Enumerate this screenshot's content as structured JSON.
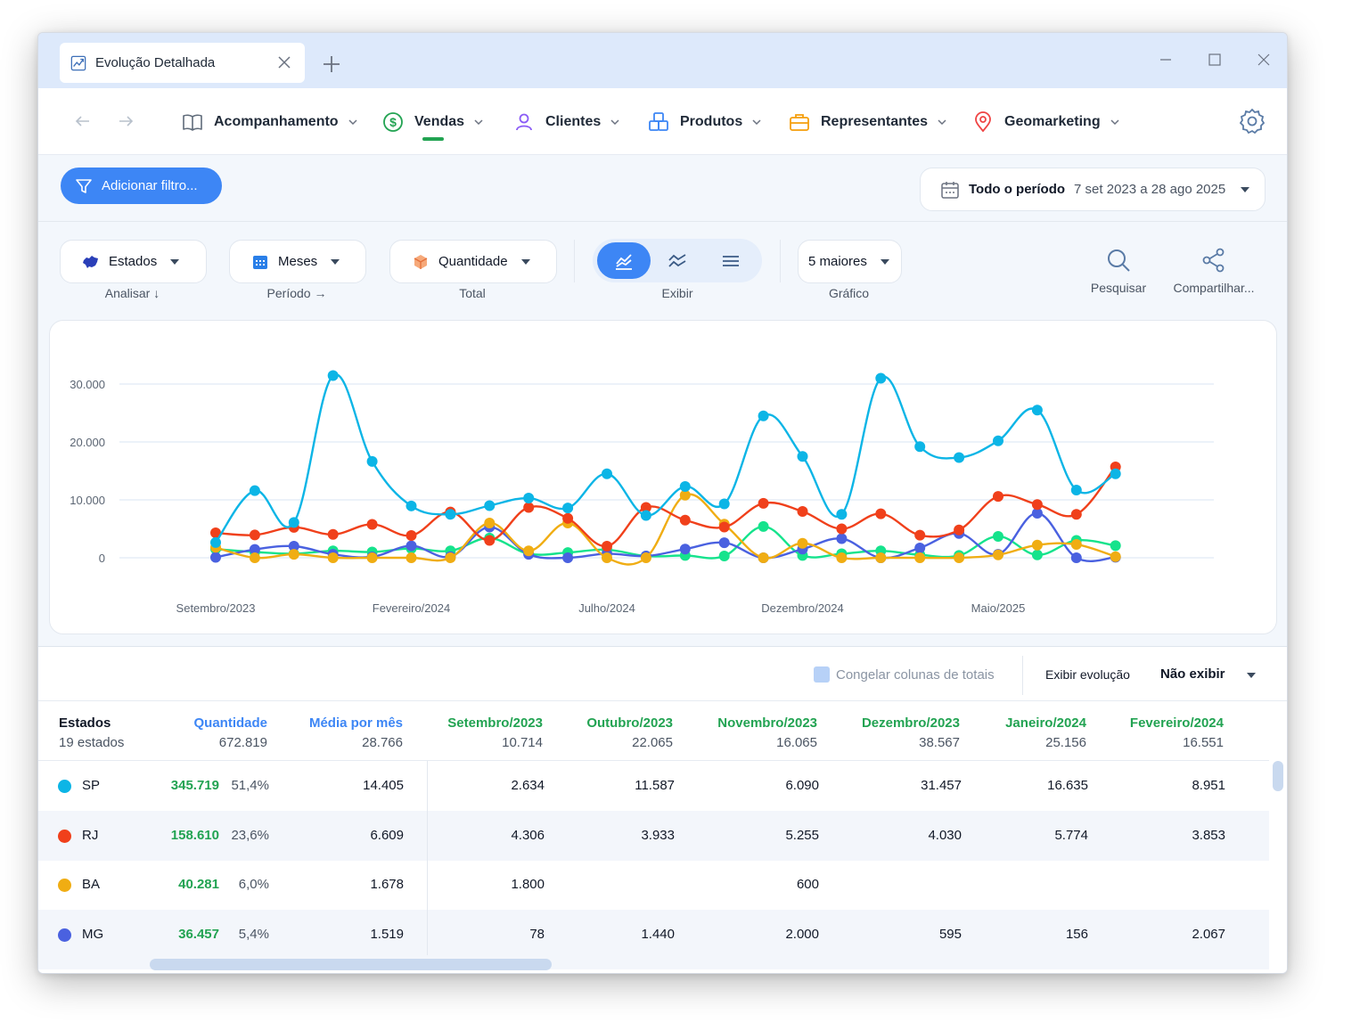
{
  "tab": {
    "title": "Evolução Detalhada"
  },
  "nav": [
    {
      "label": "Acompanhamento",
      "icon": "book-icon",
      "color": "#5f6b7a"
    },
    {
      "label": "Vendas",
      "icon": "dollar-circle-icon",
      "color": "#22a352"
    },
    {
      "label": "Clientes",
      "icon": "user-icon",
      "color": "#8b5cf6"
    },
    {
      "label": "Produtos",
      "icon": "boxes-icon",
      "color": "#3d86f5"
    },
    {
      "label": "Representantes",
      "icon": "briefcase-icon",
      "color": "#f59e0b"
    },
    {
      "label": "Geomarketing",
      "icon": "map-pin-icon",
      "color": "#ef4444"
    }
  ],
  "filter": {
    "add_label": "Adicionar filtro..."
  },
  "period": {
    "label": "Todo o período",
    "range": "7 set 2023 a 28 ago 2025"
  },
  "controls": {
    "analyze": {
      "value": "Estados",
      "caption": "Analisar ↓"
    },
    "period": {
      "value": "Meses",
      "caption": "Período →"
    },
    "total": {
      "value": "Quantidade",
      "caption": "Total"
    },
    "view": {
      "caption": "Exibir"
    },
    "chart": {
      "value": "5 maiores",
      "caption": "Gráfico"
    },
    "search": {
      "caption": "Pesquisar"
    },
    "share": {
      "caption": "Compartilhar..."
    }
  },
  "chart_data": {
    "type": "line",
    "x": [
      "Setembro/2023",
      "Outubro/2023",
      "Novembro/2023",
      "Dezembro/2023",
      "Janeiro/2024",
      "Fevereiro/2024",
      "Março/2024",
      "Abril/2024",
      "Maio/2024",
      "Junho/2024",
      "Julho/2024",
      "Agosto/2024",
      "Setembro/2024",
      "Outubro/2024",
      "Novembro/2024",
      "Dezembro/2024",
      "Janeiro/2025",
      "Fevereiro/2025",
      "Março/2025",
      "Abril/2025",
      "Maio/2025",
      "Junho/2025",
      "Julho/2025",
      "Agosto/2025"
    ],
    "x_tick_labels": [
      "Setembro/2023",
      "Fevereiro/2024",
      "Julho/2024",
      "Dezembro/2024",
      "Maio/2025"
    ],
    "y_ticks": [
      0,
      10000,
      20000,
      30000
    ],
    "y_tick_labels": [
      "0",
      "10.000",
      "20.000",
      "30.000"
    ],
    "ylim": [
      0,
      33000
    ],
    "grid": true,
    "series": [
      {
        "name": "SP",
        "color": "#0cb5e6",
        "values": [
          2634,
          11587,
          6090,
          31457,
          16635,
          8951,
          7500,
          9000,
          10300,
          8600,
          14500,
          7300,
          12300,
          9300,
          24500,
          17500,
          7500,
          31000,
          19200,
          17300,
          20200,
          25500,
          11700,
          14500
        ]
      },
      {
        "name": "RJ",
        "color": "#f0401b",
        "values": [
          4306,
          3933,
          5255,
          4030,
          5774,
          3853,
          7900,
          3000,
          8700,
          6800,
          2000,
          8700,
          6500,
          5300,
          9400,
          8000,
          5000,
          7600,
          3900,
          4800,
          10600,
          9200,
          7500,
          15700
        ]
      },
      {
        "name": "BA",
        "color": "#f0ad13",
        "values": [
          1800,
          0,
          600,
          0,
          0,
          0,
          0,
          6000,
          1200,
          6000,
          0,
          0,
          10800,
          5800,
          0,
          2500,
          0,
          0,
          0,
          0,
          500,
          2200,
          2300,
          200
        ]
      },
      {
        "name": "MG",
        "color": "#4a61e0",
        "values": [
          78,
          1440,
          2000,
          595,
          156,
          2067,
          200,
          5300,
          600,
          0,
          700,
          300,
          1500,
          2600,
          0,
          1500,
          3300,
          0,
          1700,
          4200,
          600,
          7700,
          0,
          100
        ]
      },
      {
        "name": "",
        "color": "#15e38c",
        "values": [
          1500,
          1000,
          700,
          1200,
          1000,
          1600,
          1200,
          3400,
          700,
          900,
          1400,
          300,
          400,
          300,
          5400,
          400,
          700,
          1200,
          500,
          400,
          3700,
          500,
          3000,
          2100
        ]
      }
    ]
  },
  "table": {
    "freeze_label": "Congelar colunas de totais",
    "evolution_label": "Exibir evolução",
    "evolution_value": "Não exibir",
    "columns": [
      {
        "title": "Estados",
        "sub": "19 estados",
        "color": "#111827"
      },
      {
        "title": "Quantidade",
        "sub": "672.819",
        "color": "#3d86f5"
      },
      {
        "title": "Média por mês",
        "sub": "28.766",
        "color": "#3d86f5"
      },
      {
        "title": "Setembro/2023",
        "sub": "10.714",
        "color": "#22a352"
      },
      {
        "title": "Outubro/2023",
        "sub": "22.065",
        "color": "#22a352"
      },
      {
        "title": "Novembro/2023",
        "sub": "16.065",
        "color": "#22a352"
      },
      {
        "title": "Dezembro/2023",
        "sub": "38.567",
        "color": "#22a352"
      },
      {
        "title": "Janeiro/2024",
        "sub": "25.156",
        "color": "#22a352"
      },
      {
        "title": "Fevereiro/2024",
        "sub": "16.551",
        "color": "#22a352"
      }
    ],
    "rows": [
      {
        "state": "SP",
        "color": "#0cb5e6",
        "qty": "345.719",
        "pct": "51,4%",
        "avg": "14.405",
        "months": [
          "2.634",
          "11.587",
          "6.090",
          "31.457",
          "16.635",
          "8.951"
        ]
      },
      {
        "state": "RJ",
        "color": "#f0401b",
        "qty": "158.610",
        "pct": "23,6%",
        "avg": "6.609",
        "months": [
          "4.306",
          "3.933",
          "5.255",
          "4.030",
          "5.774",
          "3.853"
        ]
      },
      {
        "state": "BA",
        "color": "#f0ad13",
        "qty": "40.281",
        "pct": "6,0%",
        "avg": "1.678",
        "months": [
          "1.800",
          "",
          "600",
          "",
          "",
          ""
        ]
      },
      {
        "state": "MG",
        "color": "#4a61e0",
        "qty": "36.457",
        "pct": "5,4%",
        "avg": "1.519",
        "months": [
          "78",
          "1.440",
          "2.000",
          "595",
          "156",
          "2.067"
        ]
      }
    ]
  }
}
